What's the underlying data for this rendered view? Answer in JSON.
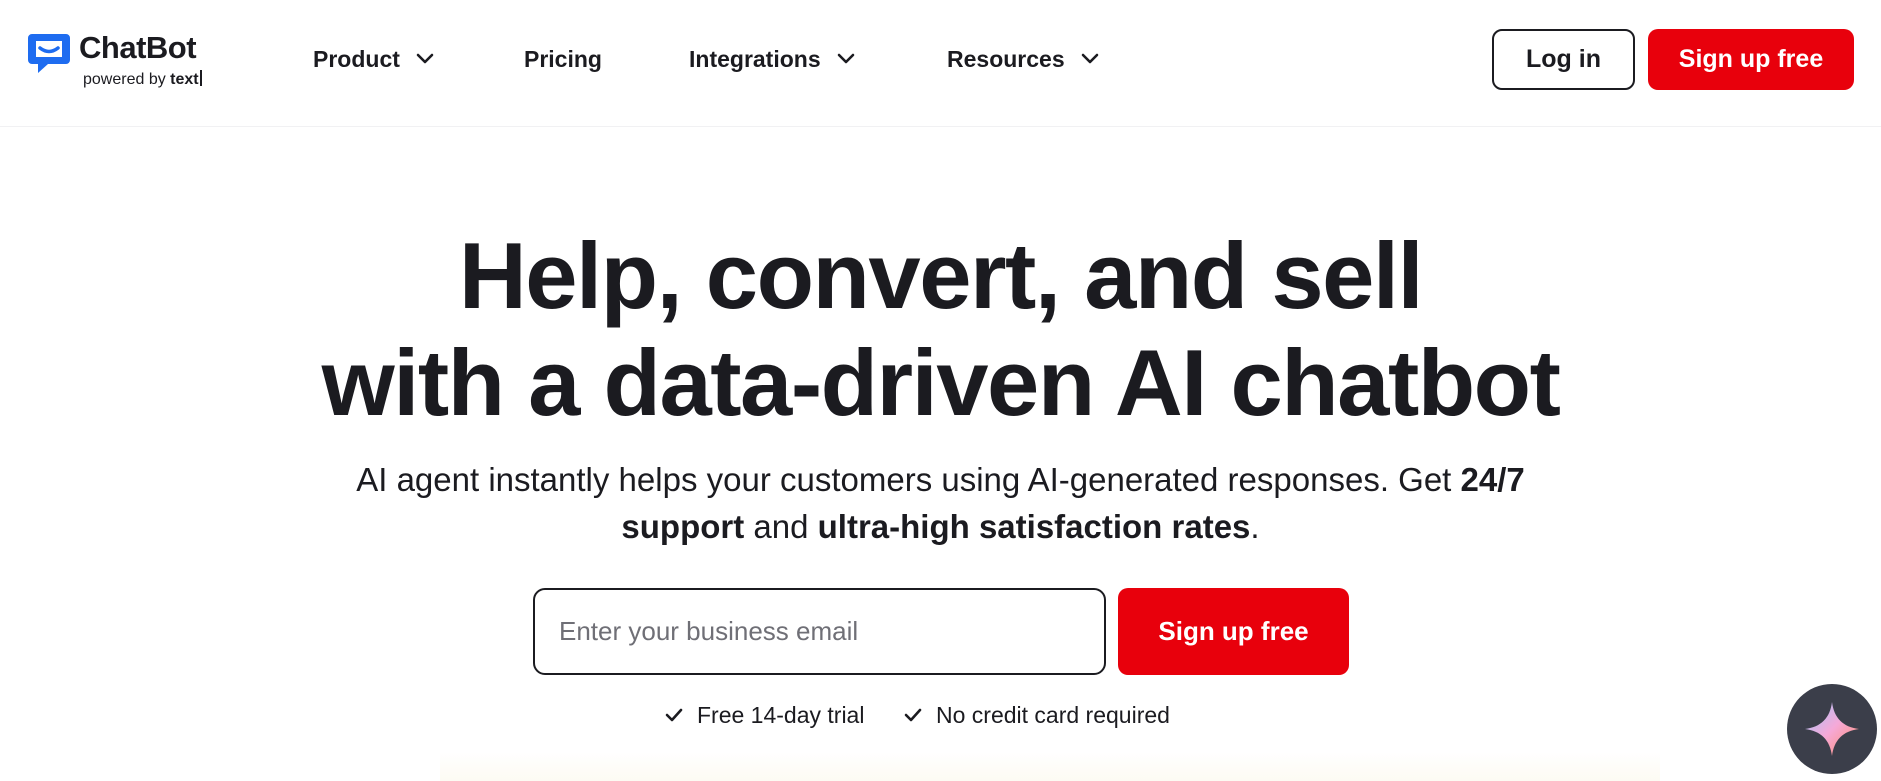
{
  "header": {
    "logo": {
      "name": "ChatBot",
      "tagline_prefix": "powered by",
      "tagline_brand": "text"
    },
    "nav": [
      {
        "label": "Product",
        "has_dropdown": true
      },
      {
        "label": "Pricing",
        "has_dropdown": false
      },
      {
        "label": "Integrations",
        "has_dropdown": true
      },
      {
        "label": "Resources",
        "has_dropdown": true
      }
    ],
    "login_label": "Log in",
    "signup_label": "Sign up free"
  },
  "hero": {
    "title_line1": "Help, convert, and sell",
    "title_line2": "with a data-driven AI chatbot",
    "subtitle_part1": "AI agent instantly helps your customers using AI-generated responses. Get ",
    "subtitle_bold1": "24/7 support",
    "subtitle_part2": " and ",
    "subtitle_bold2": "ultra-high satisfaction rates",
    "subtitle_part3": ".",
    "email_placeholder": "Enter your business email",
    "email_value": "",
    "signup_label": "Sign up free",
    "perks": [
      "Free 14-day trial",
      "No credit card required"
    ]
  },
  "icons": {
    "logo": "chat-bubble-icon",
    "dropdown": "chevron-down-icon",
    "perk": "check-icon",
    "ai_fab": "sparkle-icon"
  },
  "colors": {
    "brand_blue": "#1e6cf0",
    "accent_red": "#e8000c",
    "text_dark": "#1b1b20",
    "fab_bg": "#3b3e4a"
  }
}
